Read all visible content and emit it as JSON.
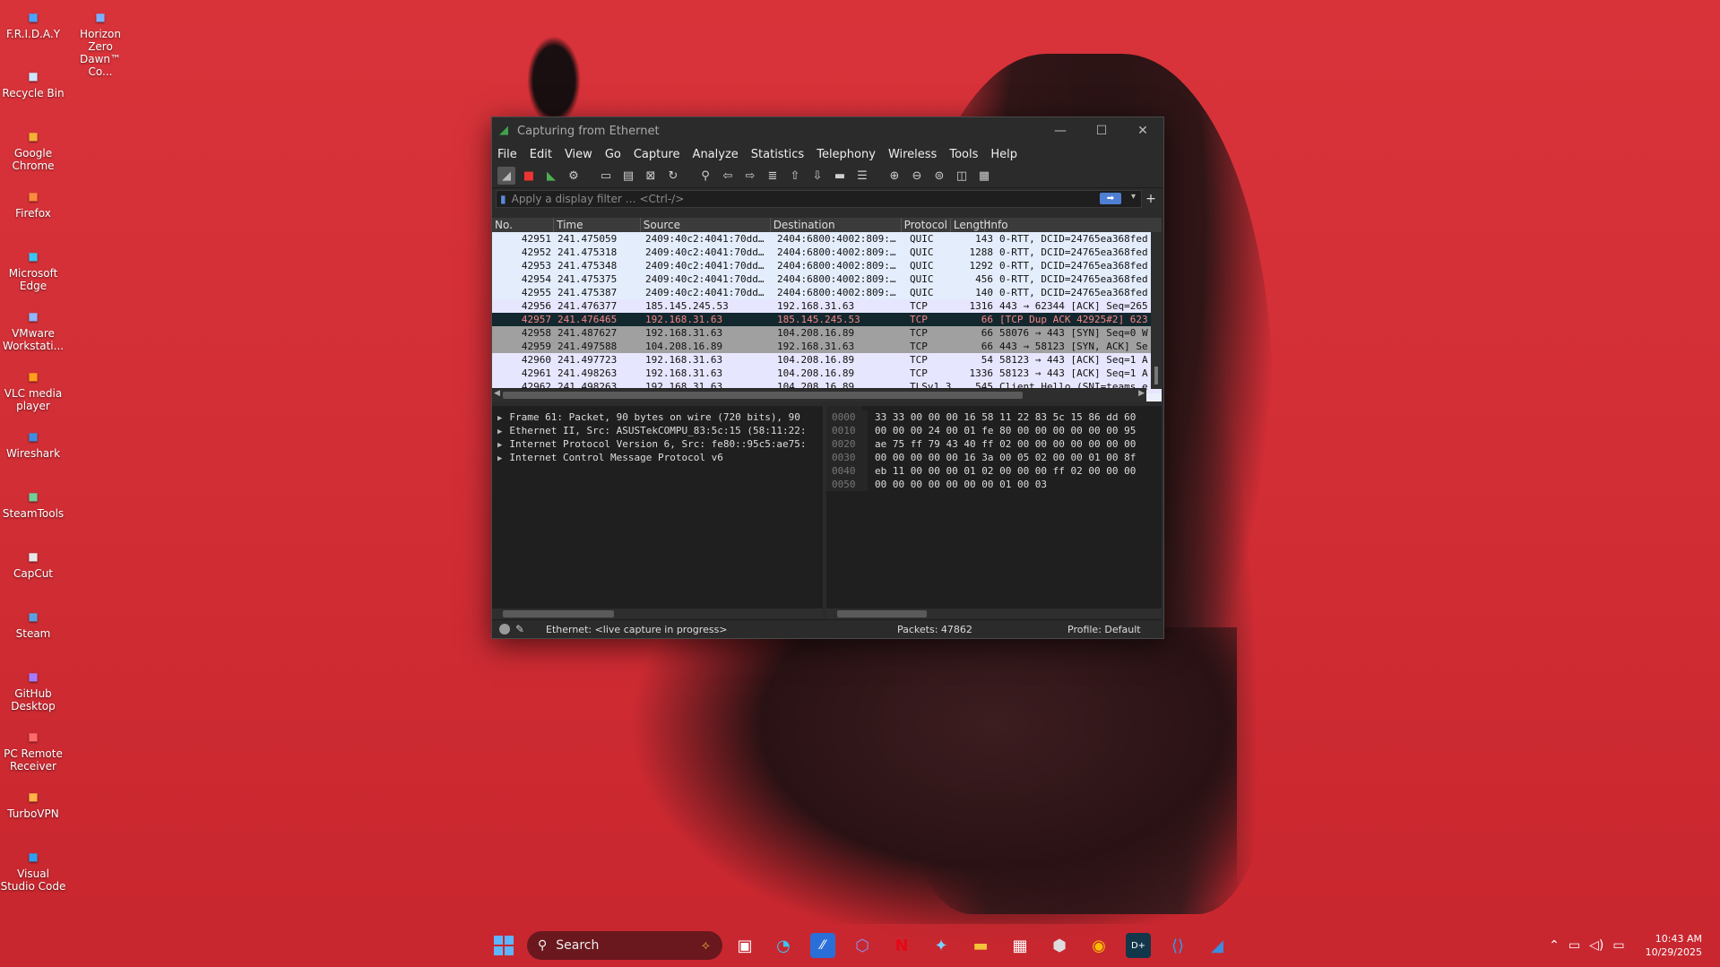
{
  "desktop": {
    "icons": [
      {
        "label": "F.R.I.D.A.Y",
        "icon": "app-icon"
      },
      {
        "label": "Horizon Zero Dawn™ Co...",
        "icon": "game-icon"
      },
      {
        "label": "Recycle Bin",
        "icon": "recycle-bin-icon"
      },
      {
        "label": "Google Chrome",
        "icon": "chrome-icon"
      },
      {
        "label": "Firefox",
        "icon": "firefox-icon"
      },
      {
        "label": "Microsoft Edge",
        "icon": "edge-icon"
      },
      {
        "label": "VMware Workstati...",
        "icon": "vmware-icon"
      },
      {
        "label": "VLC media player",
        "icon": "vlc-icon"
      },
      {
        "label": "Wireshark",
        "icon": "wireshark-icon"
      },
      {
        "label": "SteamTools",
        "icon": "steamtools-icon"
      },
      {
        "label": "CapCut",
        "icon": "capcut-icon"
      },
      {
        "label": "Steam",
        "icon": "steam-icon"
      },
      {
        "label": "GitHub Desktop",
        "icon": "github-icon"
      },
      {
        "label": "PC Remote Receiver",
        "icon": "remote-icon"
      },
      {
        "label": "TurboVPN",
        "icon": "vpn-icon"
      },
      {
        "label": "Visual Studio Code",
        "icon": "vscode-icon"
      }
    ]
  },
  "window": {
    "title": "Capturing from Ethernet",
    "controls": {
      "minimize": "—",
      "maximize": "☐",
      "close": "✕"
    }
  },
  "menu": [
    "File",
    "Edit",
    "View",
    "Go",
    "Capture",
    "Analyze",
    "Statistics",
    "Telephony",
    "Wireless",
    "Tools",
    "Help"
  ],
  "filter": {
    "placeholder": "Apply a display filter … <Ctrl-/>",
    "apply_label": "➡",
    "add_label": "+"
  },
  "packet_list": {
    "columns": [
      "No.",
      "Time",
      "Source",
      "Destination",
      "Protocol",
      "Length",
      "Info"
    ],
    "rows": [
      {
        "no": "42951",
        "time": "241.475059",
        "src": "2409:40c2:4041:70dd…",
        "dst": "2404:6800:4002:809:…",
        "proto": "QUIC",
        "len": "143",
        "info": "0-RTT, DCID=24765ea368fed",
        "style": "quic"
      },
      {
        "no": "42952",
        "time": "241.475318",
        "src": "2409:40c2:4041:70dd…",
        "dst": "2404:6800:4002:809:…",
        "proto": "QUIC",
        "len": "1288",
        "info": "0-RTT, DCID=24765ea368fed",
        "style": "quic"
      },
      {
        "no": "42953",
        "time": "241.475348",
        "src": "2409:40c2:4041:70dd…",
        "dst": "2404:6800:4002:809:…",
        "proto": "QUIC",
        "len": "1292",
        "info": "0-RTT, DCID=24765ea368fed",
        "style": "quic"
      },
      {
        "no": "42954",
        "time": "241.475375",
        "src": "2409:40c2:4041:70dd…",
        "dst": "2404:6800:4002:809:…",
        "proto": "QUIC",
        "len": "456",
        "info": "0-RTT, DCID=24765ea368fed",
        "style": "quic"
      },
      {
        "no": "42955",
        "time": "241.475387",
        "src": "2409:40c2:4041:70dd…",
        "dst": "2404:6800:4002:809:…",
        "proto": "QUIC",
        "len": "140",
        "info": "0-RTT, DCID=24765ea368fed",
        "style": "quic"
      },
      {
        "no": "42956",
        "time": "241.476377",
        "src": "185.145.245.53",
        "dst": "192.168.31.63",
        "proto": "TCP",
        "len": "1316",
        "info": "443 → 62344 [ACK] Seq=265",
        "style": "tcp"
      },
      {
        "no": "42957",
        "time": "241.476465",
        "src": "192.168.31.63",
        "dst": "185.145.245.53",
        "proto": "TCP",
        "len": "66",
        "info": "[TCP Dup ACK 42925#2] 623",
        "style": "bad"
      },
      {
        "no": "42958",
        "time": "241.487627",
        "src": "192.168.31.63",
        "dst": "104.208.16.89",
        "proto": "TCP",
        "len": "66",
        "info": "58076 → 443 [SYN] Seq=0 W",
        "style": "syn"
      },
      {
        "no": "42959",
        "time": "241.497588",
        "src": "104.208.16.89",
        "dst": "192.168.31.63",
        "proto": "TCP",
        "len": "66",
        "info": "443 → 58123 [SYN, ACK] Se",
        "style": "syn"
      },
      {
        "no": "42960",
        "time": "241.497723",
        "src": "192.168.31.63",
        "dst": "104.208.16.89",
        "proto": "TCP",
        "len": "54",
        "info": "58123 → 443 [ACK] Seq=1 A",
        "style": "tcp"
      },
      {
        "no": "42961",
        "time": "241.498263",
        "src": "192.168.31.63",
        "dst": "104.208.16.89",
        "proto": "TCP",
        "len": "1336",
        "info": "58123 → 443 [ACK] Seq=1 A",
        "style": "tcp"
      },
      {
        "no": "42962",
        "time": "241.498263",
        "src": "192.168.31.63",
        "dst": "104.208.16.89",
        "proto": "TLSv1.3",
        "len": "545",
        "info": "Client Hello (SNI=teams.e",
        "style": "tcp"
      }
    ]
  },
  "details": [
    "Frame 61: Packet, 90 bytes on wire (720 bits), 90",
    "Ethernet II, Src: ASUSTekCOMPU_83:5c:15 (58:11:22:",
    "Internet Protocol Version 6, Src: fe80::95c5:ae75:",
    "Internet Control Message Protocol v6"
  ],
  "bytes": [
    {
      "offset": "0000",
      "hex": "33 33 00 00 00 16 58 11  22 83 5c 15 86 dd 60"
    },
    {
      "offset": "0010",
      "hex": "00 00 00 24 00 01 fe 80  00 00 00 00 00 00 95"
    },
    {
      "offset": "0020",
      "hex": "ae 75 ff 79 43 40 ff 02  00 00 00 00 00 00 00"
    },
    {
      "offset": "0030",
      "hex": "00 00 00 00 00 16 3a 00  05 02 00 00 01 00 8f"
    },
    {
      "offset": "0040",
      "hex": "eb 11 00 00 00 01 02 00  00 00 ff 02 00 00 00"
    },
    {
      "offset": "0050",
      "hex": "00 00 00 00 00 00 00 01  00 03"
    }
  ],
  "status": {
    "interface": "Ethernet: <live capture in progress>",
    "packets": "Packets: 47862",
    "profile": "Profile: Default"
  },
  "taskbar": {
    "search_placeholder": "Search",
    "time": "10:43 AM",
    "date": "10/29/2025"
  },
  "colors": {
    "quic_row": "#e4edfc",
    "tcp_row": "#e7e6ff",
    "bad_row": "#12272e",
    "bad_text": "#f78787",
    "syn_row": "#a0a0a0",
    "desktop": "#d9333a"
  }
}
